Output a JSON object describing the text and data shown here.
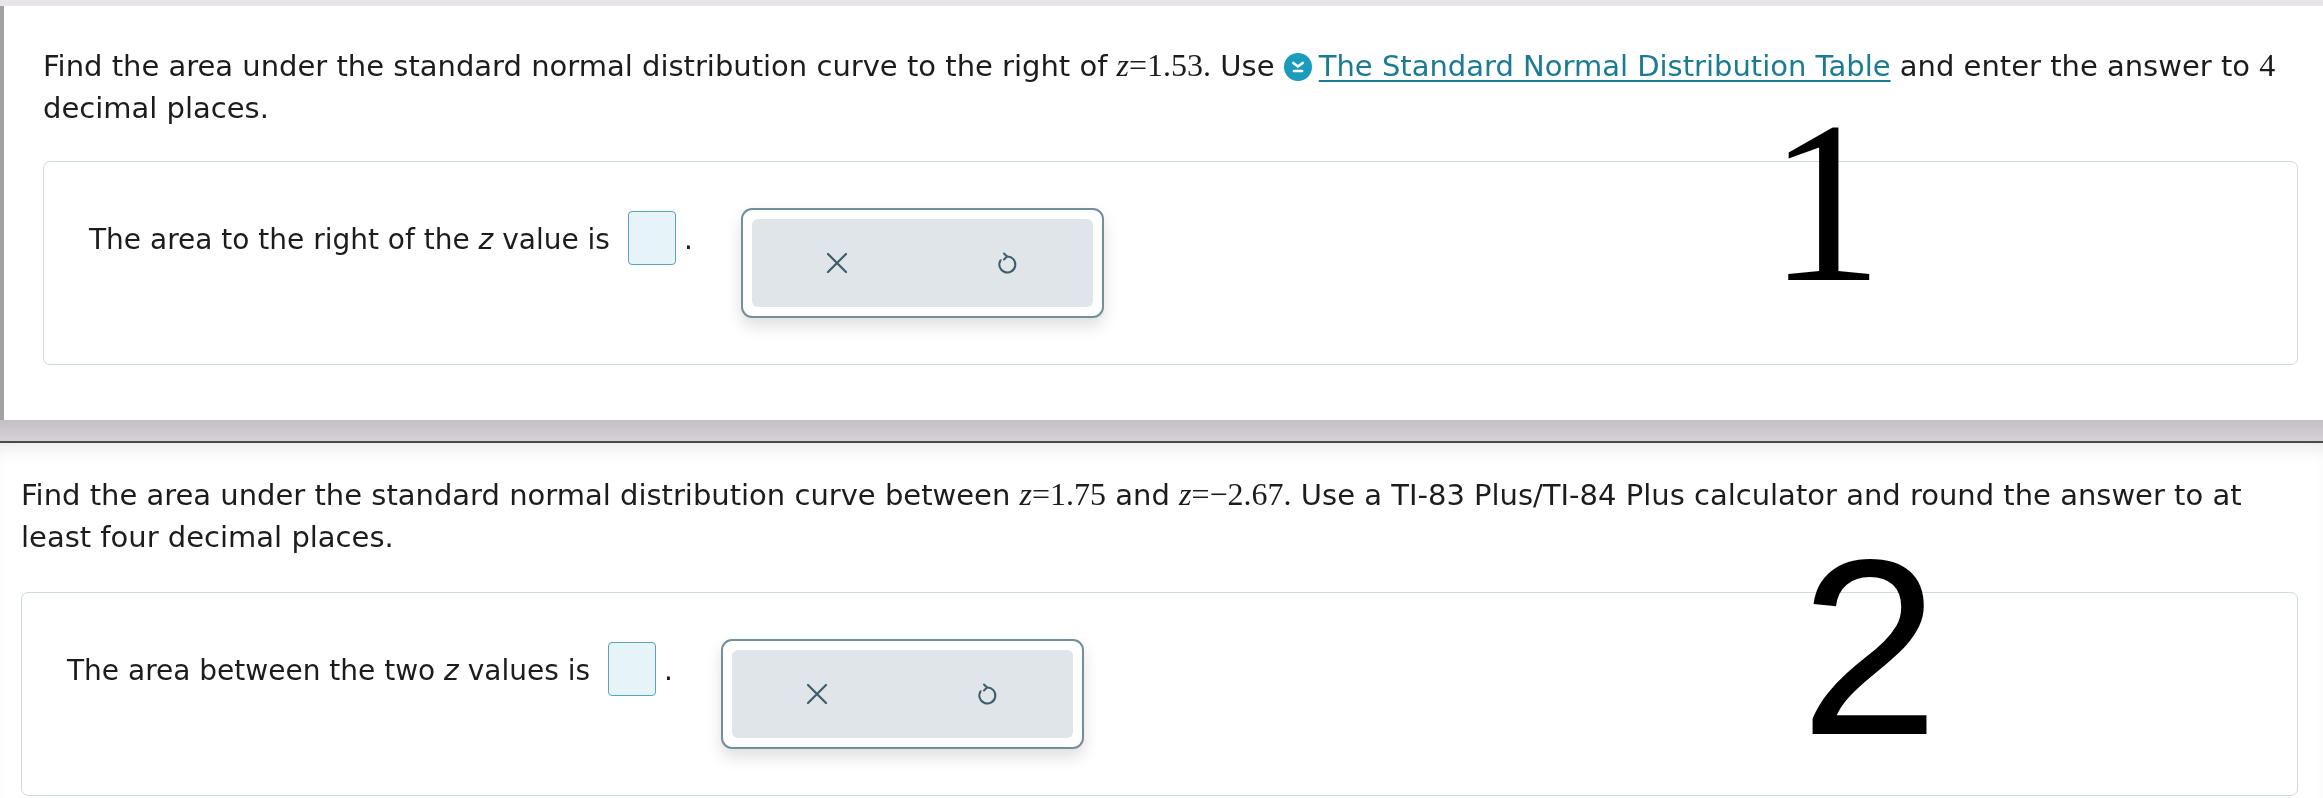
{
  "questions": [
    {
      "prompt": [
        {
          "kind": "text",
          "text": "Find the area under the standard normal distribution curve to the right of "
        },
        {
          "kind": "math",
          "text": "*z*=1.53."
        },
        {
          "kind": "text",
          "text": " Use "
        },
        {
          "kind": "link",
          "text": "The Standard Normal Distribution Table"
        },
        {
          "kind": "text",
          "text": " and enter the answer to "
        },
        {
          "kind": "math",
          "text": "4"
        },
        {
          "kind": "text",
          "text": " decimal places."
        }
      ],
      "answer": {
        "before": "The area to the right of the *z* value is",
        "after": "."
      },
      "handwriting": "1"
    },
    {
      "prompt": [
        {
          "kind": "text",
          "text": "Find the area under the standard normal distribution curve between "
        },
        {
          "kind": "math",
          "text": "*z*=1.75"
        },
        {
          "kind": "text",
          "text": " and "
        },
        {
          "kind": "math",
          "text": "*z*=−2.67."
        },
        {
          "kind": "text",
          "text": " Use a TI-83 Plus/TI-84 Plus calculator and round the answer to at least four decimal places."
        }
      ],
      "answer": {
        "before": "The area between the two *z* values is",
        "after": "."
      },
      "handwriting": "2"
    }
  ]
}
